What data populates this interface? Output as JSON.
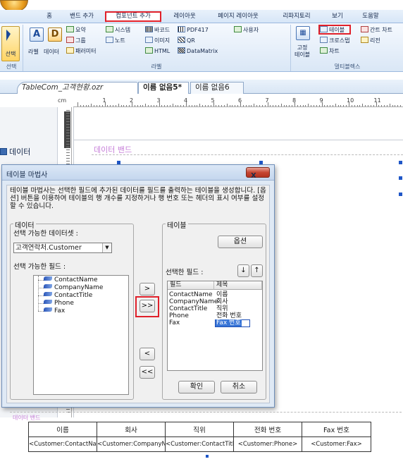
{
  "ribbon": {
    "tabs": [
      "홈",
      "밴드 추가",
      "컴포넌트 추가",
      "레이아웃",
      "페이지 레이아웃",
      "리파지토리",
      "보기",
      "도움말"
    ],
    "active_tab": "컴포넌트 추가",
    "groups": {
      "select": {
        "button": "선택",
        "label": "선택"
      },
      "label_group": {
        "label": "라벨",
        "big_label": "라벨",
        "big_data": "데이터",
        "summary": "요약",
        "group": "그룹",
        "parameter": "패러미터",
        "system": "시스템",
        "note": "노트",
        "barcode": "바코드",
        "image": "이미지",
        "html": "HTML",
        "pdf417": "PDF417",
        "qr": "QR",
        "datamatrix": "DataMatrix",
        "user": "사용자"
      },
      "multiband": {
        "label": "멀티블렉스",
        "fixed_table": "고정\n테이블",
        "table": "테이블",
        "gantt": "간트 차트",
        "crosstab": "크로스탭",
        "lichen": "리전",
        "chart": "차트"
      }
    }
  },
  "doc_tabs": [
    "TableCom_고객현황.ozr",
    "이름 없음5*",
    "이름 없음6"
  ],
  "ruler": {
    "unit": "cm",
    "numbers": [
      "1",
      "2",
      "3",
      "4",
      "5",
      "6",
      "7",
      "8",
      "9",
      "10",
      "11"
    ]
  },
  "canvas": {
    "band_label": "데이터 밴드",
    "side_label": "데이터"
  },
  "dialog": {
    "title": "테이블 마법사",
    "close": "X",
    "description": "테이블 마법사는 선택한 필드에 추가된 데이터를 필드를 출력하는 테이블을 생성합니다. [옵션] 버튼을 이용하여 테이블의 행 개수를 지정하거나 행 번호 또는 헤더의 표시 여부를 설정할 수 있습니다.",
    "data_section": {
      "title": "데이터",
      "dataset_label": "선택 가능한 데이터셋 :",
      "dataset_value": "고객연락처.Customer",
      "fields_label": "선택 가능한 필드 :",
      "fields": [
        "ContactName",
        "CompanyName",
        "ContactTitle",
        "Phone",
        "Fax"
      ]
    },
    "move_buttons": [
      ">",
      ">>",
      "<",
      "<<"
    ],
    "table_section": {
      "title": "테이블",
      "options_button": "옵션",
      "selected_label": "선택한 필드 :",
      "down_button": "↓",
      "up_button": "↑",
      "columns": [
        "필드",
        "제목"
      ],
      "rows": [
        {
          "field": "ContactName",
          "title": "이름"
        },
        {
          "field": "CompanyName",
          "title": "회사"
        },
        {
          "field": "ContactTitle",
          "title": "직위"
        },
        {
          "field": "Phone",
          "title": "전화 번호"
        },
        {
          "field": "Fax",
          "title": "Fax 번호"
        }
      ]
    },
    "ok": "확인",
    "cancel": "취소"
  },
  "result": {
    "band_label": "데이터 밴드",
    "headers": [
      "이름",
      "회사",
      "직위",
      "전화 번호",
      "Fax 번호"
    ],
    "cells": [
      "<Customer:ContactName>",
      "<Customer:CompanyName>",
      "<Customer:ContactTitle>",
      "<Customer:Phone>",
      "<Customer:Fax>"
    ]
  },
  "colors": {
    "highlight": "#e0202a",
    "band": "#c77fd9",
    "accent": "#1f56c7"
  }
}
